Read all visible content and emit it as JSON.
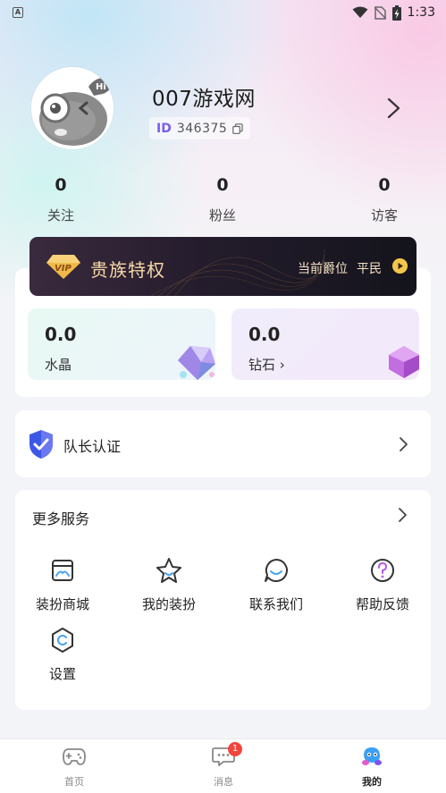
{
  "status_bar": {
    "left_icon": "A",
    "time": "1:33",
    "icons": [
      "wifi-icon",
      "no-sim-icon",
      "battery-charging-icon"
    ]
  },
  "profile": {
    "username": "007游戏网",
    "id_tag": "ID",
    "id_value": "346375",
    "avatar_icon": "mascot-avatar-icon"
  },
  "stats": [
    {
      "value": "0",
      "label": "关注"
    },
    {
      "value": "0",
      "label": "粉丝"
    },
    {
      "value": "0",
      "label": "访客"
    }
  ],
  "vip": {
    "badge_text": "VIP",
    "title": "贵族特权",
    "status_label": "当前爵位",
    "status_value": "平民",
    "colors": {
      "gold": "#f3c64b",
      "text": "#f6d9a6"
    }
  },
  "wallet": {
    "crystal": {
      "value": "0.0",
      "label": "水晶"
    },
    "diamond": {
      "value": "0.0",
      "label": "钻石",
      "chevron": "›"
    }
  },
  "leader": {
    "label": "队长认证",
    "icon": "shield-check-icon"
  },
  "services": {
    "title": "更多服务",
    "items": [
      {
        "label": "装扮商城",
        "icon": "shop-icon"
      },
      {
        "label": "我的装扮",
        "icon": "star-face-icon"
      },
      {
        "label": "联系我们",
        "icon": "chat-smile-icon"
      },
      {
        "label": "帮助反馈",
        "icon": "help-icon"
      },
      {
        "label": "设置",
        "icon": "settings-icon"
      }
    ]
  },
  "tabbar": {
    "items": [
      {
        "label": "首页",
        "icon": "gamepad-icon"
      },
      {
        "label": "消息",
        "icon": "message-icon",
        "badge": "1"
      },
      {
        "label": "我的",
        "icon": "profile-mascot-icon",
        "active": true
      }
    ]
  }
}
